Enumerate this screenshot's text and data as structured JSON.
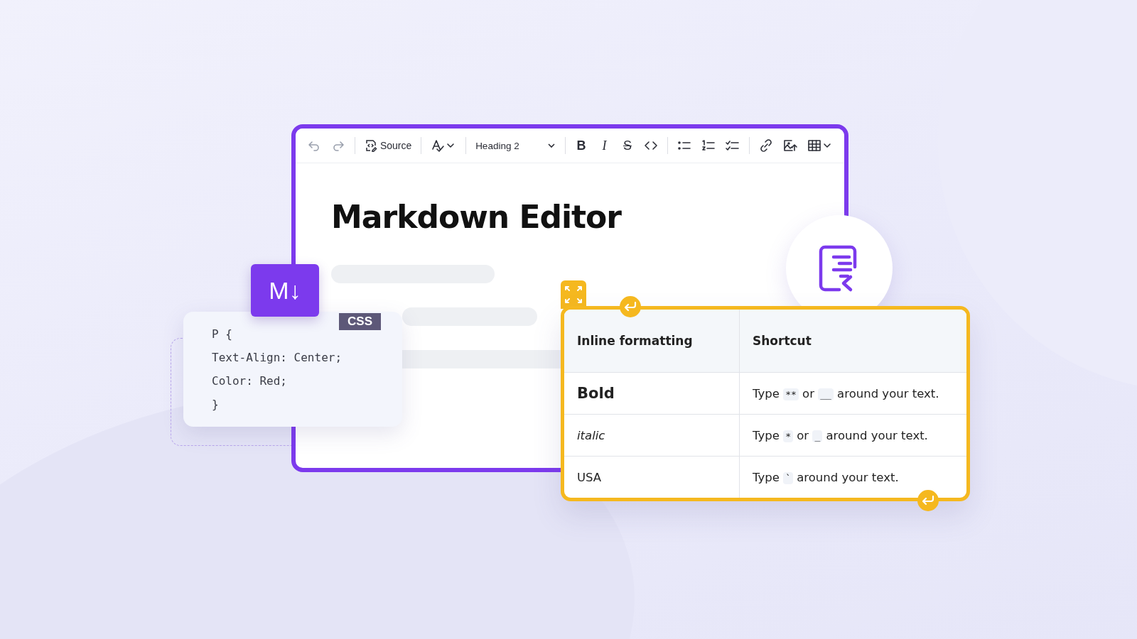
{
  "toolbar": [
    {
      "kind": "undo",
      "disabled": true
    },
    {
      "kind": "redo",
      "disabled": true
    },
    {
      "kind": "separator"
    },
    {
      "kind": "source",
      "label": "Source",
      "disabled": false
    },
    {
      "kind": "separator"
    },
    {
      "kind": "spellcheck",
      "disabled": false
    },
    {
      "kind": "separator"
    },
    {
      "kind": "heading",
      "value": "Heading 2",
      "disabled": false
    },
    {
      "kind": "separator"
    },
    {
      "kind": "bold",
      "glyph": "B",
      "disabled": false
    },
    {
      "kind": "italic",
      "glyph": "I",
      "disabled": false
    },
    {
      "kind": "strike",
      "glyph": "S",
      "disabled": false
    },
    {
      "kind": "code",
      "disabled": false
    },
    {
      "kind": "separator"
    },
    {
      "kind": "bullets",
      "disabled": false
    },
    {
      "kind": "numbers",
      "disabled": false
    },
    {
      "kind": "todo",
      "disabled": false
    },
    {
      "kind": "separator"
    },
    {
      "kind": "link",
      "disabled": false
    },
    {
      "kind": "image",
      "disabled": false
    },
    {
      "kind": "table",
      "disabled": false
    }
  ],
  "document": {
    "title": "Markdown Editor"
  },
  "markdown_badge": "M↓",
  "code_card": {
    "tag": "CSS",
    "lines": [
      "P {",
      "Text-Align: Center;",
      "Color: Red;",
      "}"
    ]
  },
  "table": {
    "columns": [
      "Inline formatting",
      "Shortcut"
    ],
    "rows": [
      {
        "kind": "bold",
        "name": "Bold",
        "shortcut": [
          {
            "text": "Type"
          },
          {
            "code": "**"
          },
          {
            "text": "or"
          },
          {
            "code": "__"
          },
          {
            "text": "around your text."
          }
        ]
      },
      {
        "kind": "italic",
        "name": "italic",
        "shortcut": [
          {
            "text": "Type"
          },
          {
            "code": "*"
          },
          {
            "text": "or"
          },
          {
            "code": "_"
          },
          {
            "text": "around your text."
          }
        ]
      },
      {
        "kind": "plain",
        "name": "USA",
        "shortcut": [
          {
            "text": "Type"
          },
          {
            "code": "`"
          },
          {
            "text": "around your text."
          }
        ]
      }
    ]
  }
}
